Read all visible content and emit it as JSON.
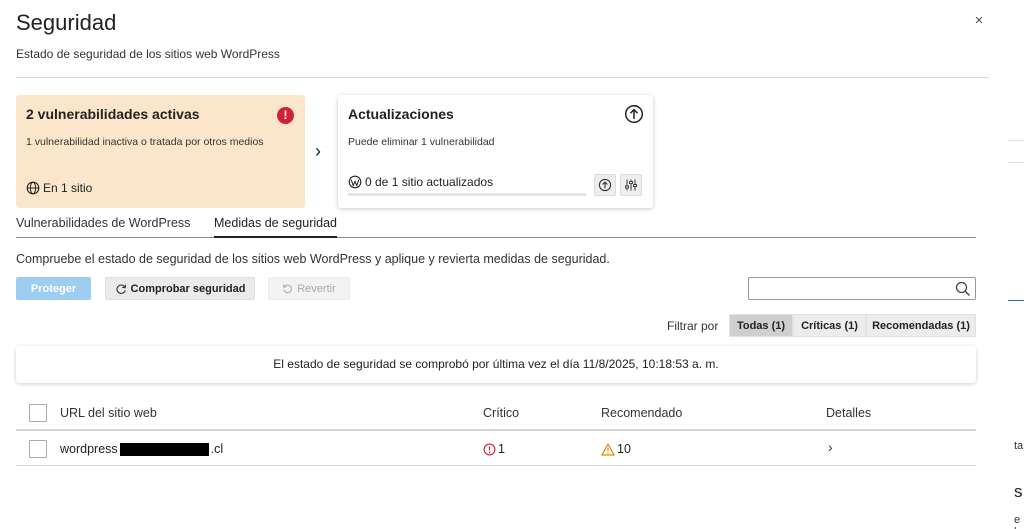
{
  "dialog": {
    "title": "Seguridad",
    "subtitle": "Estado de seguridad de los sitios web WordPress",
    "close_label": "×"
  },
  "cards": {
    "vulnerabilities": {
      "title": "2 vulnerabilidades activas",
      "description": "1 vulnerabilidad inactiva o tratada por otros medios",
      "footer": "En 1 sitio",
      "alert_icon": "!",
      "color": "#fbe6cc"
    },
    "updates": {
      "title": "Actualizaciones",
      "description": "Puede eliminar 1 vulnerabilidad",
      "footer": "0 de 1 sitio actualizados",
      "progress": 0
    },
    "arrow": "›"
  },
  "tabs": [
    {
      "label": "Vulnerabilidades de WordPress",
      "active": false
    },
    {
      "label": "Medidas de seguridad",
      "active": true
    }
  ],
  "intro": "Compruebe el estado de seguridad de los sitios web WordPress y aplique y revierta medidas de seguridad.",
  "toolbar": {
    "protect_label": "Proteger",
    "check_label": "Comprobar seguridad",
    "revert_label": "Revertir",
    "search_value": ""
  },
  "filter": {
    "label": "Filtrar por",
    "options": [
      "Todas (1)",
      "Críticas (1)",
      "Recomendadas (1)"
    ],
    "selected": "Todas (1)"
  },
  "notice": "El estado de seguridad se comprobó por última vez el día 11/8/2025, 10:18:53 a. m.",
  "table": {
    "columns": [
      "URL del sitio web",
      "Crítico",
      "Recomendado",
      "Detalles"
    ],
    "rows": [
      {
        "url_prefix": "wordpress",
        "url_suffix": ".cl",
        "critical": "1",
        "recommended": "10",
        "details": "›"
      }
    ]
  },
  "colors": {
    "accent": "#9dcdf0",
    "danger": "#d0213a",
    "warning": "#e08a00",
    "progress_fill": "#2b7a3b"
  },
  "icons": [
    "alert-icon",
    "globe-icon",
    "upload-icon",
    "wordpress-icon",
    "update-icon",
    "settings-sliders-icon",
    "refresh-icon",
    "revert-icon",
    "search-icon",
    "critical-icon",
    "warning-icon",
    "chevron-right-icon",
    "close-icon"
  ]
}
